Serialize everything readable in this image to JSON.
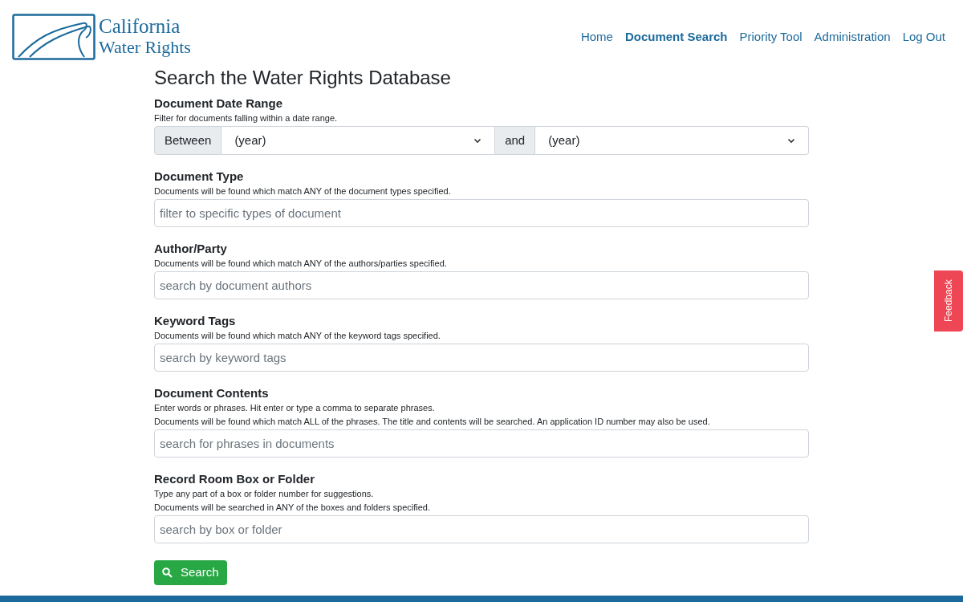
{
  "logo": {
    "line1": "California",
    "line2": "Water Rights"
  },
  "nav": [
    {
      "label": "Home",
      "selected": false
    },
    {
      "label": "Document Search",
      "selected": true
    },
    {
      "label": "Priority Tool",
      "selected": false
    },
    {
      "label": "Administration",
      "selected": false
    },
    {
      "label": "Log Out",
      "selected": false
    }
  ],
  "title": "Search the Water Rights Database",
  "sections": [
    {
      "kind": "date-range",
      "label": "Document Date Range",
      "hints": [
        "Filter for documents falling within a date range."
      ],
      "prefix": "Between",
      "start": "(year)",
      "joiner": "and",
      "end": "(year)"
    },
    {
      "kind": "text",
      "label": "Document Type",
      "hints": [
        "Documents will be found which match ANY of the document types specified."
      ],
      "placeholder": "filter to specific types of document"
    },
    {
      "kind": "text",
      "label": "Author/Party",
      "hints": [
        "Documents will be found which match ANY of the authors/parties specified."
      ],
      "placeholder": "search by document authors"
    },
    {
      "kind": "text",
      "label": "Keyword Tags",
      "hints": [
        "Documents will be found which match ANY of the keyword tags specified."
      ],
      "placeholder": "search by keyword tags"
    },
    {
      "kind": "text",
      "label": "Document Contents",
      "hints": [
        "Enter words or phrases. Hit enter or type a comma to separate phrases.",
        "Documents will be found which match ALL of the phrases. The title and contents will be searched. An application ID number may also be used."
      ],
      "placeholder": "search for phrases in documents"
    },
    {
      "kind": "text",
      "label": "Record Room Box or Folder",
      "hints": [
        "Type any part of a box or folder number for suggestions.",
        "Documents will be searched in ANY of the boxes and folders specified."
      ],
      "placeholder": "search by box or folder"
    }
  ],
  "search_button": "Search",
  "feedback": "Feedback"
}
